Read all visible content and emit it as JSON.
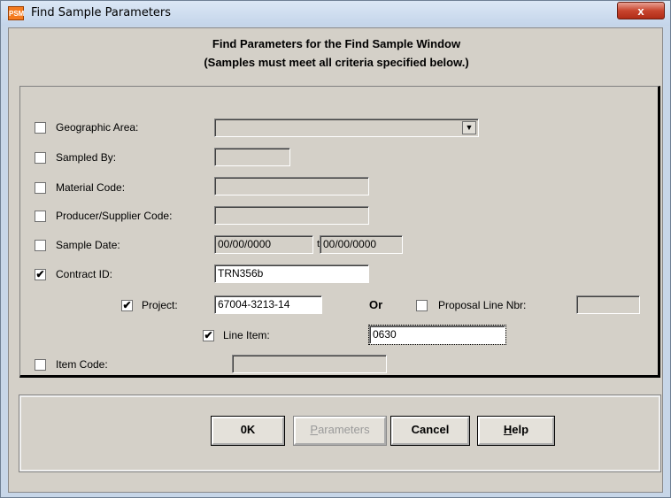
{
  "window": {
    "title": "Find Sample Parameters",
    "close_label": "x",
    "icon_text": "P S M"
  },
  "heading": {
    "line1": "Find Parameters for the Find Sample Window",
    "line2": "(Samples must meet all criteria specified below.)"
  },
  "criteria": {
    "geographic_area": {
      "label": "Geographic Area:",
      "checked": false,
      "value": ""
    },
    "sampled_by": {
      "label": "Sampled By:",
      "checked": false,
      "value": ""
    },
    "material_code": {
      "label": "Material Code:",
      "checked": false,
      "value": ""
    },
    "producer_supplier_code": {
      "label": "Producer/Supplier Code:",
      "checked": false,
      "value": ""
    },
    "sample_date": {
      "label": "Sample Date:",
      "checked": false,
      "from": "00/00/0000",
      "till_label": "till",
      "to": "00/00/0000"
    },
    "contract_id": {
      "label": "Contract ID:",
      "checked": true,
      "value": "TRN356b"
    },
    "project": {
      "label": "Project:",
      "checked": true,
      "value": "67004-3213-14"
    },
    "or_label": "Or",
    "proposal_line_nbr": {
      "label": "Proposal Line Nbr:",
      "checked": false,
      "value": ""
    },
    "line_item": {
      "label": "Line Item:",
      "checked": true,
      "value": "0630"
    },
    "item_code": {
      "label": "Item Code:",
      "checked": false,
      "value": ""
    }
  },
  "buttons": {
    "ok": "0K",
    "parameters_rest": "arameters",
    "parameters_mnemonic": "P",
    "cancel": "Cancel",
    "help_mnemonic": "H",
    "help_rest": "elp"
  },
  "checkmark": "✔",
  "icons": {
    "dropdown": "▼"
  }
}
